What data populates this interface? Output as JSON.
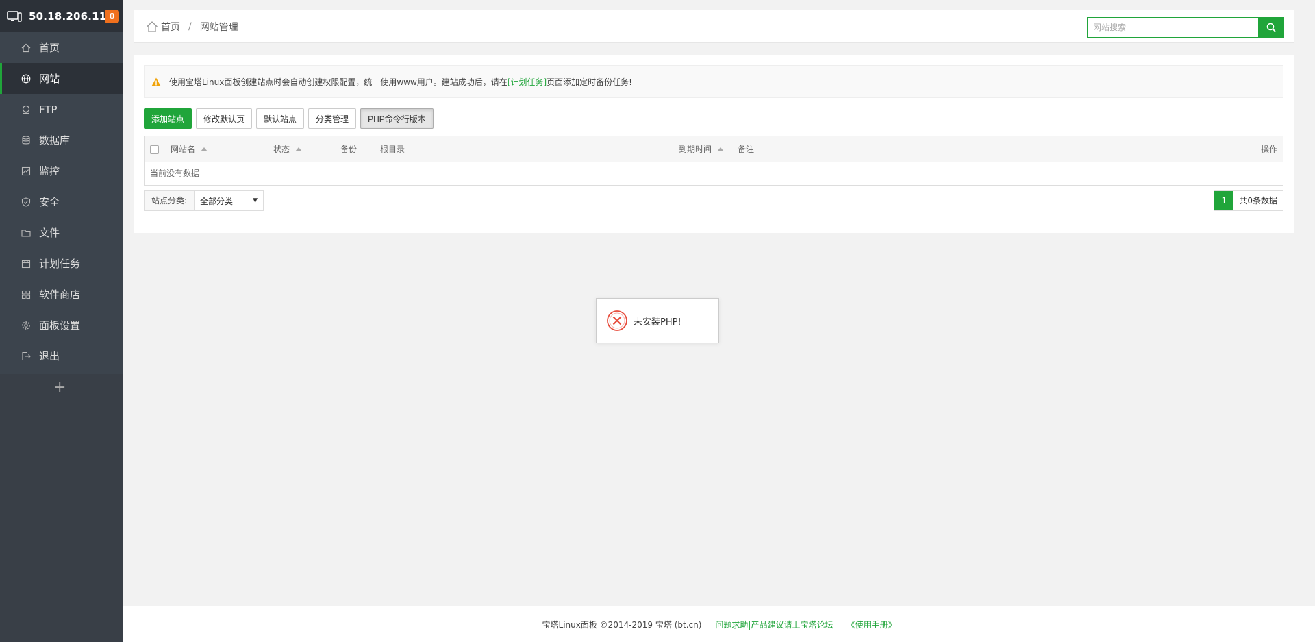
{
  "sidebar": {
    "server_ip": "50.18.206.110",
    "notification_count": "0",
    "items": [
      {
        "label": "首页",
        "icon": "home-icon"
      },
      {
        "label": "网站",
        "icon": "globe-icon"
      },
      {
        "label": "FTP",
        "icon": "ftp-icon"
      },
      {
        "label": "数据库",
        "icon": "database-icon"
      },
      {
        "label": "监控",
        "icon": "monitor-icon"
      },
      {
        "label": "安全",
        "icon": "shield-icon"
      },
      {
        "label": "文件",
        "icon": "folder-icon"
      },
      {
        "label": "计划任务",
        "icon": "calendar-icon"
      },
      {
        "label": "软件商店",
        "icon": "grid-icon"
      },
      {
        "label": "面板设置",
        "icon": "gear-icon"
      },
      {
        "label": "退出",
        "icon": "logout-icon"
      }
    ],
    "active_index": 1,
    "add_label": "+"
  },
  "header": {
    "breadcrumb_home": "首页",
    "breadcrumb_sep": "/",
    "breadcrumb_current": "网站管理",
    "search_placeholder": "网站搜索"
  },
  "notice": {
    "text_before": "使用宝塔Linux面板创建站点时会自动创建权限配置，统一使用www用户。建站成功后，请在",
    "link": "[计划任务]",
    "text_after": "页面添加定时备份任务!"
  },
  "toolbar": {
    "add_site": "添加站点",
    "edit_default_page": "修改默认页",
    "default_site": "默认站点",
    "category_manage": "分类管理",
    "php_cli_version": "PHP命令行版本"
  },
  "table": {
    "columns": {
      "site_name": "网站名",
      "status": "状态",
      "backup": "备份",
      "root_dir": "根目录",
      "expire_time": "到期时间",
      "remark": "备注",
      "actions": "操作"
    },
    "empty_text": "当前没有数据"
  },
  "filter": {
    "label": "站点分类:",
    "selected": "全部分类"
  },
  "pagination": {
    "current_page": "1",
    "total_text": "共0条数据"
  },
  "toast": {
    "message": "未安装PHP!"
  },
  "footer": {
    "copyright": "宝塔Linux面板 ©2014-2019 宝塔 (bt.cn)",
    "help_link": "问题求助|产品建议请上宝塔论坛",
    "manual_link": "《使用手册》"
  },
  "colors": {
    "accent": "#20a53a",
    "sidebar_bg": "#3c444d",
    "sidebar_dark": "#2c3138",
    "badge": "#f0701d",
    "error": "#e74c3c"
  }
}
